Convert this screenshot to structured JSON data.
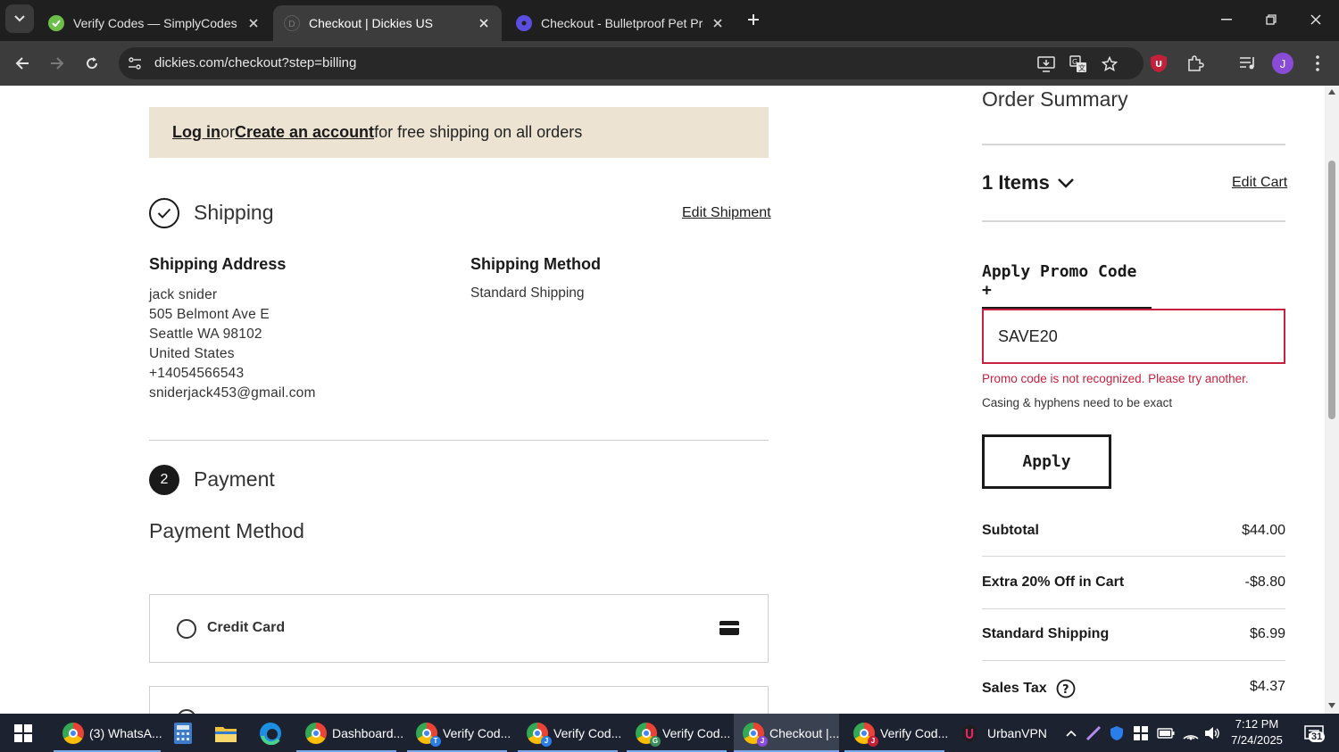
{
  "browser": {
    "tabs": [
      {
        "title": "Verify Codes — SimplyCodes",
        "favicon_color": "#6cc04a",
        "active": false
      },
      {
        "title": "Checkout | Dickies US",
        "favicon_color": "#3c3c3c",
        "active": true
      },
      {
        "title": "Checkout - Bulletproof Pet Prod",
        "favicon_color": "#5b4de0",
        "active": false
      }
    ],
    "url": "dickies.com/checkout?step=billing",
    "profile_initial": "J"
  },
  "banner": {
    "login": "Log in ",
    "or": " or ",
    "create": "Create an account",
    "rest": " for free shipping on all orders"
  },
  "shipping": {
    "title": "Shipping",
    "edit": "Edit Shipment",
    "address_heading": "Shipping Address",
    "address_lines": [
      "jack snider",
      "505 Belmont Ave E",
      "Seattle WA 98102",
      "United States",
      "+14054566543",
      "sniderjack453@gmail.com"
    ],
    "method_heading": "Shipping Method",
    "method": "Standard Shipping"
  },
  "payment": {
    "step_number": "2",
    "title": "Payment",
    "method_heading": "Payment Method",
    "options": [
      {
        "label": "Credit Card",
        "icon": "credit-card-icon"
      }
    ]
  },
  "summary": {
    "title": "Order Summary",
    "items": "1 Items",
    "edit_cart": "Edit Cart",
    "promo_toggle": "Apply Promo Code +",
    "promo_value": "SAVE20",
    "promo_error": "Promo code is not recognized. Please try another.",
    "promo_hint": "Casing & hyphens need to be exact",
    "apply": "Apply",
    "rows": [
      {
        "label": "Subtotal",
        "value": "$44.00"
      },
      {
        "label": "Extra 20% Off in Cart",
        "value": "-$8.80"
      },
      {
        "label": "Standard Shipping",
        "value": "$6.99"
      },
      {
        "label": "Sales Tax",
        "value": "$4.37"
      }
    ]
  },
  "taskbar": {
    "apps": [
      {
        "label": "(3) WhatsA...",
        "badge": ""
      },
      {
        "label": "Dashboard...",
        "badge": ""
      },
      {
        "label": "Verify Cod...",
        "badge": "T"
      },
      {
        "label": "Verify Cod...",
        "badge": "J"
      },
      {
        "label": "Verify Cod...",
        "badge": "G"
      },
      {
        "label": "Checkout |...",
        "badge": "J"
      },
      {
        "label": "Verify Cod...",
        "badge": "J"
      },
      {
        "label": "UrbanVPN",
        "badge": ""
      }
    ],
    "time": "7:12 PM",
    "date": "7/24/2025",
    "notification_count": "31"
  },
  "colors": {
    "error": "#c8203e",
    "banner_bg": "#ece3d2",
    "chrome_dark": "#1f1f1f",
    "taskbar": "#1c2230"
  }
}
